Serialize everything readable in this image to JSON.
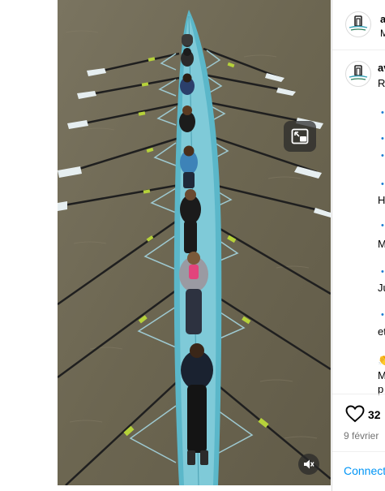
{
  "post": {
    "author_initial": "a",
    "author_initial_2": "av",
    "header_sub": "M",
    "caption_lines": [
      "R",
      "H",
      "M",
      "Ju",
      "et",
      "M",
      "p"
    ],
    "bullets": [
      "•",
      "•",
      "•",
      "•",
      "•",
      "•",
      "•"
    ],
    "clap_emoji": "👏",
    "likes": "32",
    "date": "9 février",
    "connect_label": "Connect"
  },
  "media": {
    "type": "video",
    "water_color": "#6f6a55",
    "boat_color": "#5bb7c9",
    "pip_icon": "picture-in-picture-icon",
    "mute_icon": "muted-speaker-icon"
  },
  "icons": {
    "like": "heart-outline-icon"
  }
}
